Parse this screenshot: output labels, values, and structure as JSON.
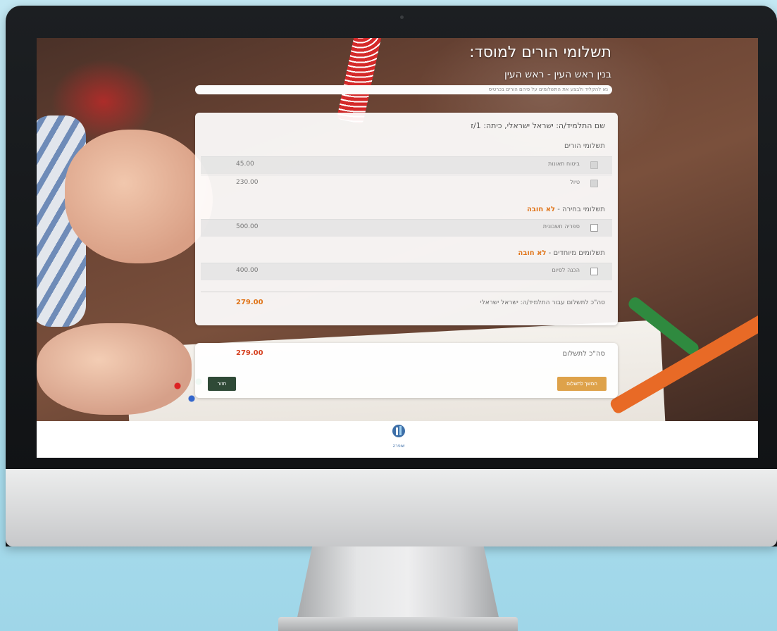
{
  "page": {
    "title": "תשלומי הורים למוסד:",
    "subtitle": "בנין ראש העין - ראש העין",
    "notice": "נא להקליד ולבצע את התשלומים על פיהם הורים בכרטיס"
  },
  "student": {
    "line": "שם התלמיד/ה: ישראל ישראלי, כיתה: 1/ז"
  },
  "sections": [
    {
      "title": "תשלומי הורים",
      "optional": "",
      "items": [
        {
          "label": "ביטוח תאונות",
          "amount": "45.00",
          "disabled": true
        },
        {
          "label": "טיול",
          "amount": "230.00",
          "disabled": true
        }
      ]
    },
    {
      "title": "תשלומי בחירה - ",
      "optional": "לא חובה",
      "items": [
        {
          "label": "ספריה חשבונית",
          "amount": "500.00",
          "disabled": false
        }
      ]
    },
    {
      "title": "תשלומים מיוחדים - ",
      "optional": "לא חובה",
      "items": [
        {
          "label": "הכנה לסיום",
          "amount": "400.00",
          "disabled": false
        }
      ]
    }
  ],
  "student_total": {
    "label": "סה\"כ לתשלום עבור התלמיד/ה: ישראל ישראלי",
    "amount": "279.00"
  },
  "summary": {
    "label": "סה\"כ לתשלום",
    "amount": "279.00",
    "pay_button": "המשך לתשלום",
    "back_button": "חזור"
  },
  "footer": {
    "logo_text": "שופרה"
  },
  "colors": {
    "accent_orange": "#e0751a",
    "total_red": "#d64322",
    "pay_button": "#dea24a",
    "back_button": "#2f4a37"
  }
}
